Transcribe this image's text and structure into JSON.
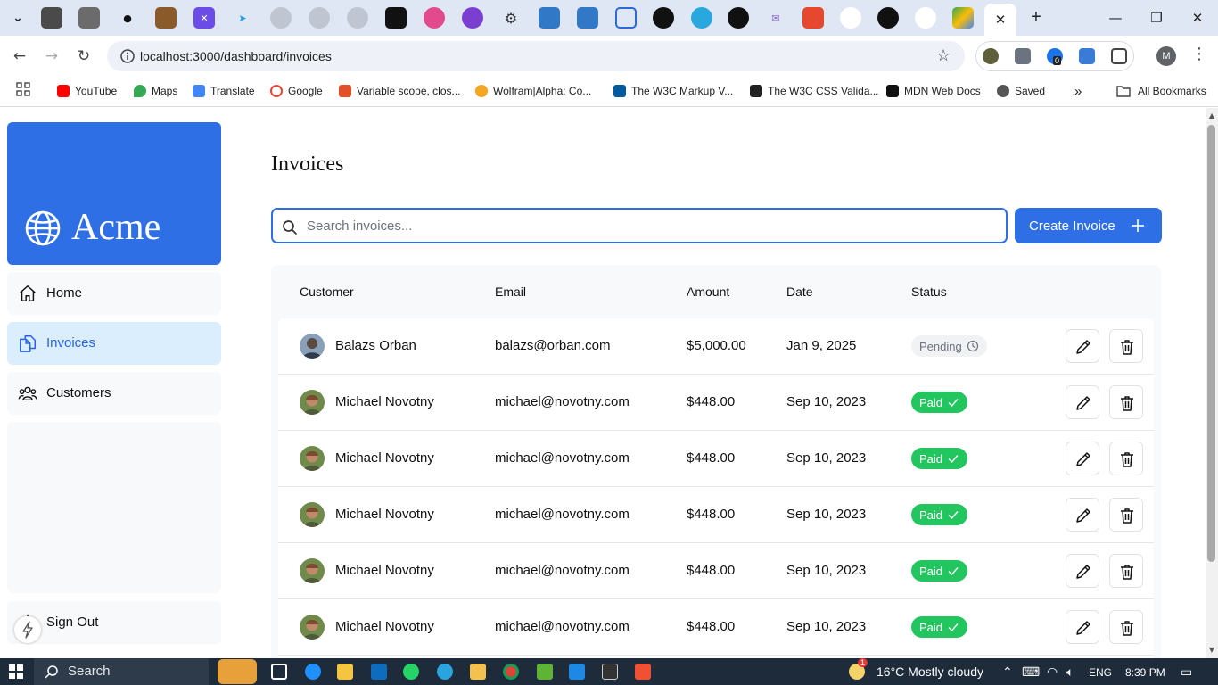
{
  "browser": {
    "url": "localhost:3000/dashboard/invoices",
    "close_tab_glyph": "✕",
    "new_tab_glyph": "+",
    "profile_initial": "M",
    "extension_badge": "0",
    "bookmarks": [
      {
        "label": "YouTube",
        "color": "#ff0000"
      },
      {
        "label": "Maps",
        "color": "#34a853"
      },
      {
        "label": "Translate",
        "color": "#4285f4"
      },
      {
        "label": "Google",
        "color": "#ea4335"
      },
      {
        "label": "Variable scope, clos...",
        "color": "#e34f26"
      },
      {
        "label": "Wolfram|Alpha: Co...",
        "color": "#f5a623"
      },
      {
        "label": "The W3C Markup V...",
        "color": "#005a9c"
      },
      {
        "label": "The W3C CSS Valida...",
        "color": "#222222"
      },
      {
        "label": "MDN Web Docs",
        "color": "#111111"
      },
      {
        "label": "Saved",
        "color": "#555555"
      }
    ],
    "more_bookmarks_glyph": "»",
    "all_bookmarks": "All Bookmarks"
  },
  "sidebar": {
    "logo_text": "Acme",
    "items": [
      {
        "label": "Home",
        "icon": "home-icon"
      },
      {
        "label": "Invoices",
        "icon": "document-icon"
      },
      {
        "label": "Customers",
        "icon": "users-icon"
      }
    ],
    "sign_out": "Sign Out"
  },
  "main": {
    "title": "Invoices",
    "search_placeholder": "Search invoices...",
    "create_label": "Create Invoice",
    "table": {
      "headers": [
        "Customer",
        "Email",
        "Amount",
        "Date",
        "Status"
      ],
      "rows": [
        {
          "name": "Balazs Orban",
          "email": "balazs@orban.com",
          "amount": "$5,000.00",
          "date": "Jan 9, 2025",
          "status": "Pending"
        },
        {
          "name": "Michael Novotny",
          "email": "michael@novotny.com",
          "amount": "$448.00",
          "date": "Sep 10, 2023",
          "status": "Paid"
        },
        {
          "name": "Michael Novotny",
          "email": "michael@novotny.com",
          "amount": "$448.00",
          "date": "Sep 10, 2023",
          "status": "Paid"
        },
        {
          "name": "Michael Novotny",
          "email": "michael@novotny.com",
          "amount": "$448.00",
          "date": "Sep 10, 2023",
          "status": "Paid"
        },
        {
          "name": "Michael Novotny",
          "email": "michael@novotny.com",
          "amount": "$448.00",
          "date": "Sep 10, 2023",
          "status": "Paid"
        },
        {
          "name": "Michael Novotny",
          "email": "michael@novotny.com",
          "amount": "$448.00",
          "date": "Sep 10, 2023",
          "status": "Paid"
        }
      ]
    }
  },
  "taskbar": {
    "search_label": "Search",
    "weather": "16°C  Mostly cloudy",
    "language": "ENG",
    "time": "8:39 PM",
    "weather_badge": "1"
  },
  "colors": {
    "accent": "#2f6fe6",
    "paid": "#22c55e",
    "pending_bg": "#f1f2f4",
    "active_nav": "#dbeefd"
  }
}
